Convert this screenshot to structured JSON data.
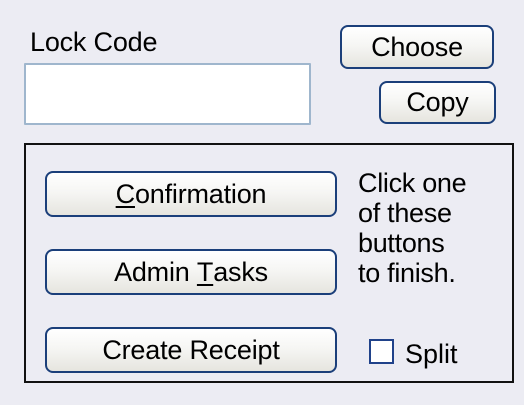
{
  "lock_code": {
    "label": "Lock Code",
    "value": "",
    "placeholder": ""
  },
  "buttons": {
    "choose": "Choose",
    "copy": "Copy",
    "confirmation": {
      "mnemonic": "C",
      "rest": "onfirmation"
    },
    "admin_tasks": {
      "before": "Admin ",
      "mnemonic": "T",
      "after": "asks"
    },
    "create_receipt": "Create Receipt"
  },
  "hint": {
    "lines": [
      "Click one",
      "of these",
      "buttons",
      "to finish."
    ]
  },
  "split": {
    "label": "Split",
    "checked": false
  }
}
